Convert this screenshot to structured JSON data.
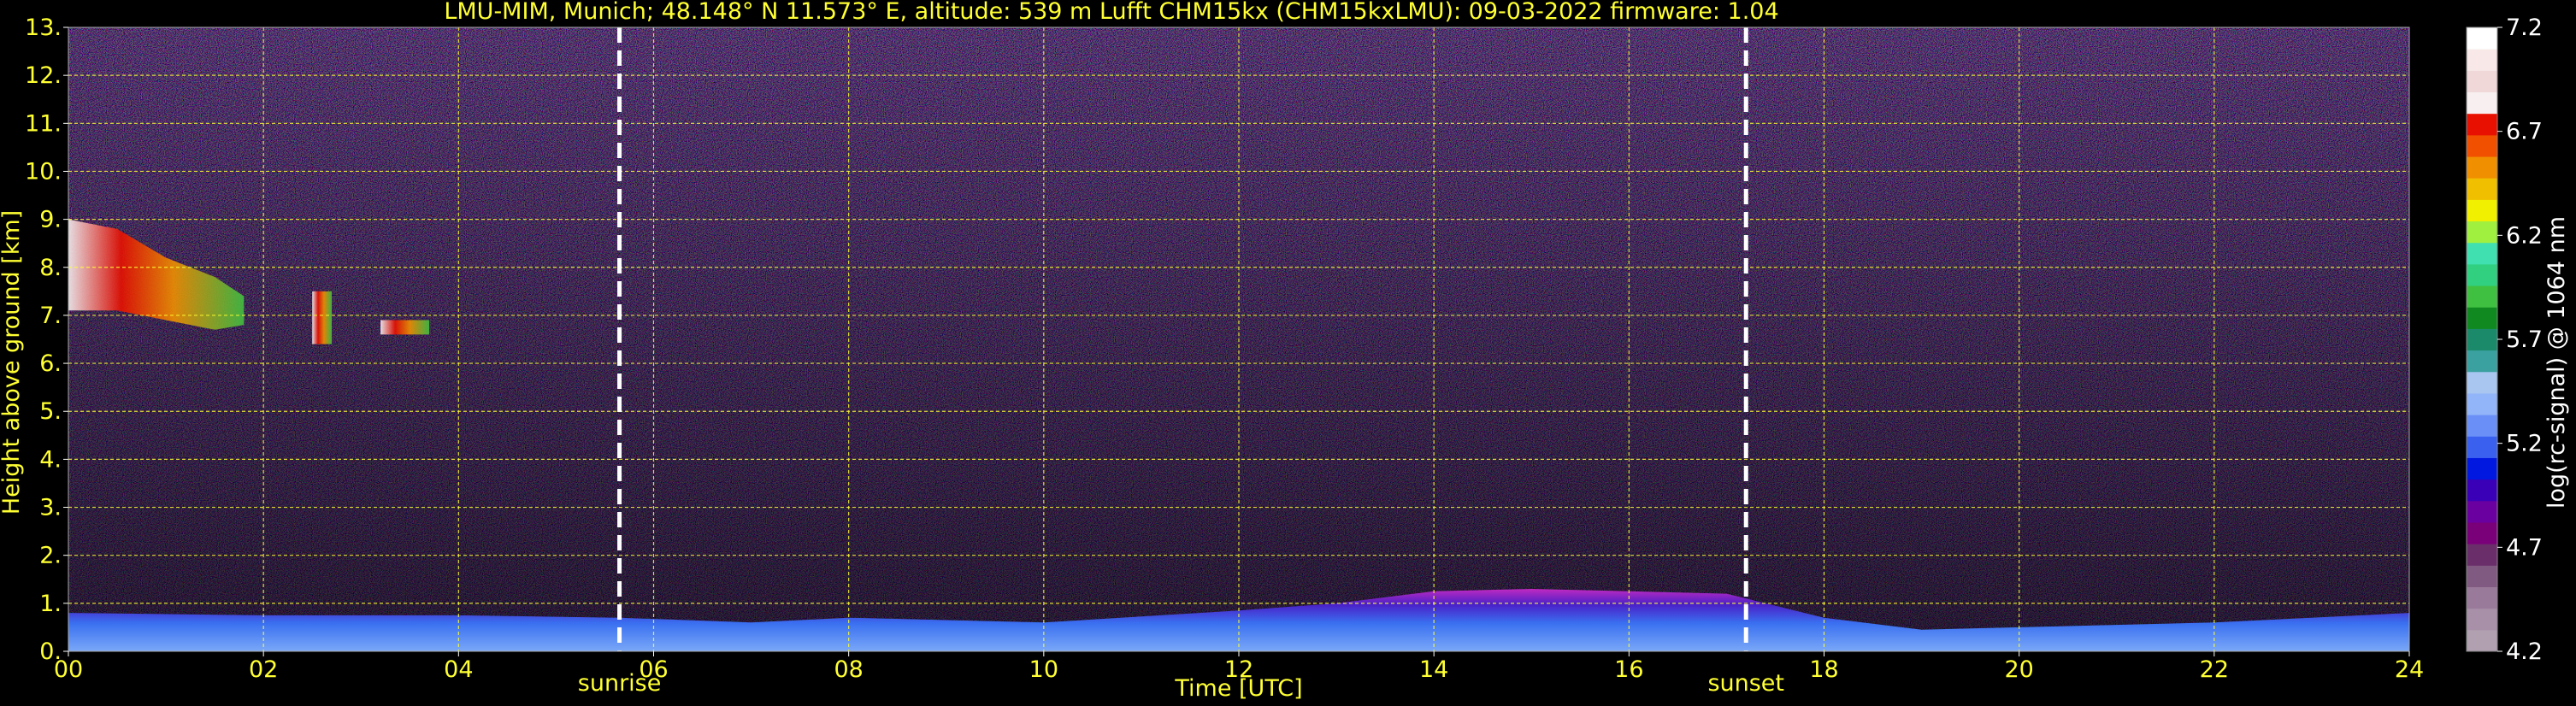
{
  "chart_data": {
    "type": "heatmap",
    "title": "LMU-MIM, Munich; 48.148° N 11.573° E, altitude: 539 m    Lufft CHM15kx (CHM15kxLMU): 09-03-2022    firmware: 1.04",
    "xlabel": "Time [UTC]",
    "ylabel": "Height above ground [km]",
    "xlim": [
      0,
      24
    ],
    "ylim": [
      0,
      13
    ],
    "x_tick_labels": [
      "00",
      "02",
      "04",
      "06",
      "08",
      "10",
      "12",
      "14",
      "16",
      "18",
      "20",
      "22",
      "24"
    ],
    "y_tick_labels": [
      "0.",
      "1.",
      "2.",
      "3.",
      "4.",
      "5.",
      "6.",
      "7.",
      "8.",
      "9.",
      "10.",
      "11.",
      "12.",
      "13."
    ],
    "grid": true,
    "events": [
      {
        "label": "sunrise",
        "time_utc": 5.65
      },
      {
        "label": "sunset",
        "time_utc": 17.2
      }
    ],
    "colorbar": {
      "label": "log(rc-signal) @ 1064 nm",
      "min": 4.2,
      "max": 7.2,
      "tick_labels": [
        "4.2",
        "4.7",
        "5.2",
        "5.7",
        "6.2",
        "6.7",
        "7.2"
      ],
      "colors": [
        "#b0a0b0",
        "#a890a8",
        "#9a7a9a",
        "#805a80",
        "#6a2e6a",
        "#7a007a",
        "#6a00a0",
        "#3a00b8",
        "#0018e0",
        "#3a60f0",
        "#6a90f8",
        "#92b4f8",
        "#a8c6f0",
        "#3aa0a0",
        "#1a8a6a",
        "#108a20",
        "#40c040",
        "#30d080",
        "#40e0b0",
        "#a0f040",
        "#f0f000",
        "#f0c000",
        "#f09000",
        "#f05000",
        "#e81000",
        "#f8f0f0",
        "#f0d8d8",
        "#f8e8e8",
        "#ffffff"
      ]
    },
    "layers": [
      {
        "label": "boundary layer",
        "t": [
          0,
          2,
          4,
          5.65,
          7,
          8,
          10,
          12,
          13,
          14,
          15,
          16,
          17,
          17.2,
          18,
          19,
          20,
          22,
          24
        ],
        "top_km": [
          0.8,
          0.75,
          0.75,
          0.7,
          0.6,
          0.7,
          0.6,
          0.85,
          1.0,
          1.25,
          1.3,
          1.25,
          1.2,
          1.1,
          0.7,
          0.45,
          0.5,
          0.6,
          0.8
        ]
      },
      {
        "label": "cirrus",
        "t": [
          0,
          0.5,
          1,
          1.5,
          1.8
        ],
        "base_km": [
          7.1,
          7.1,
          6.9,
          6.7,
          6.8
        ],
        "top_km": [
          9.0,
          8.8,
          8.2,
          7.8,
          7.4
        ]
      },
      {
        "label": "cirrus",
        "t": [
          2.5,
          2.7
        ],
        "base_km": [
          6.4,
          6.4
        ],
        "top_km": [
          7.5,
          7.5
        ]
      },
      {
        "label": "cirrus",
        "t": [
          3.2,
          3.7
        ],
        "base_km": [
          6.6,
          6.6
        ],
        "top_km": [
          6.9,
          6.9
        ]
      }
    ]
  }
}
